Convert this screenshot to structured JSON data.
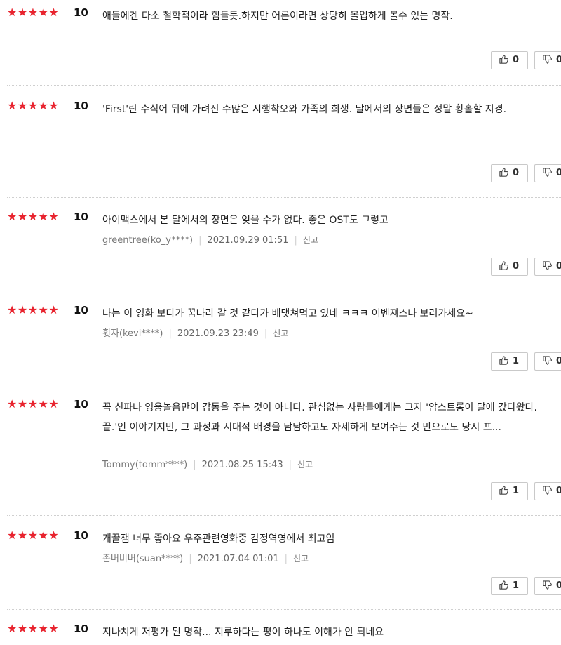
{
  "reviews": [
    {
      "stars": "★★★★★",
      "score": "10",
      "text": "애들에겐 다소 철학적이라 힘들듯.하지만 어른이라면 상당히 몰입하게 볼수 있는 명작.",
      "author": "",
      "date": "",
      "report": "",
      "up": "0",
      "down": "0"
    },
    {
      "stars": "★★★★★",
      "score": "10",
      "text": "'First'란 수식어 뒤에 가려진 수많은 시행착오와 가족의 희생. 달에서의 장면들은 정말 황홀할 지경.",
      "author": "",
      "date": "",
      "report": "",
      "up": "0",
      "down": "0"
    },
    {
      "stars": "★★★★★",
      "score": "10",
      "text": "아이맥스에서 본 달에서의 장면은 잊을 수가 없다. 좋은 OST도 그렇고",
      "author": "greentree(ko_y****)",
      "date": "2021.09.29 01:51",
      "report": "신고",
      "up": "0",
      "down": "0"
    },
    {
      "stars": "★★★★★",
      "score": "10",
      "text": "나는 이 영화 보다가 꿈나라 갈 것 같다가 베댓쳐먹고 있네 ㅋㅋㅋ 어벤져스나 보러가세요~",
      "author": "휫자(kevi****)",
      "date": "2021.09.23 23:49",
      "report": "신고",
      "up": "1",
      "down": "0"
    },
    {
      "stars": "★★★★★",
      "score": "10",
      "text": "꼭 신파나 영웅놀음만이 감동을 주는 것이 아니다. 관심없는 사람들에게는 그저 '암스트롱이 달에 갔다왔다. 끝.'인 이야기지만, 그 과정과 시대적 배경을 담담하고도 자세하게 보여주는 것 만으로도 당시 프...",
      "author": "Tommy(tomm****)",
      "date": "2021.08.25 15:43",
      "report": "신고",
      "up": "1",
      "down": "0"
    },
    {
      "stars": "★★★★★",
      "score": "10",
      "text": "개꿀잼 너무 좋아요 우주관련영화중 감정역영에서 최고임",
      "author": "존버비버(suan****)",
      "date": "2021.07.04 01:01",
      "report": "신고",
      "up": "1",
      "down": "0"
    },
    {
      "stars": "★★★★★",
      "score": "10",
      "text": "지나치게 저평가 된 명작... 지루하다는 평이 하나도 이해가 안 되네요",
      "author": "",
      "date": "",
      "report": "",
      "up": "",
      "down": ""
    }
  ],
  "icons": {
    "up": "thumbs-up-icon",
    "down": "thumbs-down-icon"
  },
  "colors": {
    "star": "#e8232e"
  }
}
